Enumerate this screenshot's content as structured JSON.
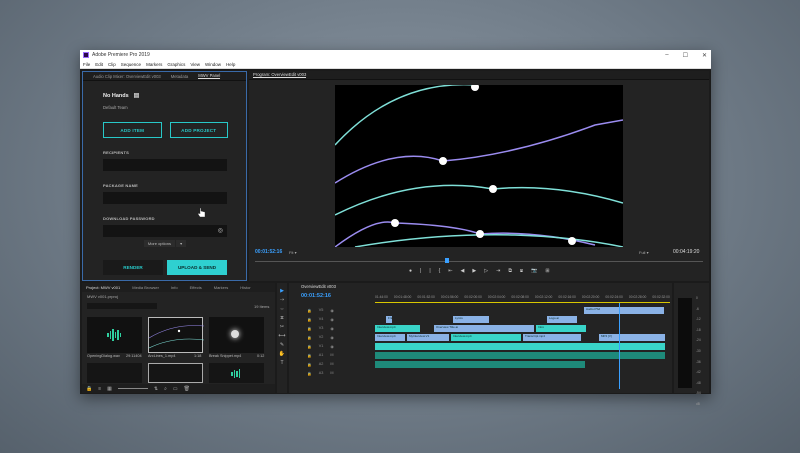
{
  "window": {
    "title": "Adobe Premiere Pro 2019",
    "controls": [
      "–",
      "☐",
      "✕"
    ]
  },
  "menu": [
    "File",
    "Edit",
    "Clip",
    "Sequence",
    "Markers",
    "Graphics",
    "View",
    "Window",
    "Help"
  ],
  "mwv_panel": {
    "tabs": [
      "Audio Clip Mixer: OverviewEdit v003",
      "Metadata",
      "MWV Panel"
    ],
    "active_tab": "MWV Panel",
    "name": "No Hands",
    "team": "Default Team",
    "add_item": "ADD ITEM",
    "add_project": "ADD PROJECT",
    "recipients_label": "RECIPIENTS",
    "package_label": "PACKAGE NAME",
    "password_label": "DOWNLOAD PASSWORD",
    "more_options": "More options",
    "render": "RENDER",
    "upload_send": "UPLOAD & SEND"
  },
  "program_monitor": {
    "tab": "Program: OverviewEdit v003",
    "timecode": "00:01:52:16",
    "fit": "Fit",
    "quality": "Full",
    "duration": "00:04:19:20",
    "transport": [
      "●",
      "|",
      "|",
      "{",
      "⇤",
      "◀",
      "▶",
      "▷",
      "⇥",
      "⧉",
      "⧈",
      "📷",
      "⊞"
    ]
  },
  "project_panel": {
    "tabs": [
      "Project: MWV v001",
      "Media Browser",
      "Info",
      "Effects",
      "Markers",
      "Histor"
    ],
    "file": "MWV v001.prproj",
    "count": "19 Items",
    "items": [
      {
        "name": "OpeningDialog.wav",
        "duration": "29:11404"
      },
      {
        "name": "ArcLines_1.mp4",
        "duration": "1:18"
      },
      {
        "name": "Break Snippet.mp4",
        "duration": "0:12"
      }
    ]
  },
  "tools": [
    "▶",
    "⇢",
    "⇔",
    "⧖",
    "✂",
    "⟷",
    "✎",
    "✋",
    "T"
  ],
  "timeline": {
    "tab": "OverviewEdit v003",
    "timecode": "00:01:52:16",
    "ruler": [
      "01:44:00",
      "00:01:48:00",
      "00:01:52:00",
      "00:01:56:00",
      "00:02:00:00",
      "00:02:04:00",
      "00:02:08:00",
      "00:02:12:00",
      "00:02:16:00",
      "00:02:20:00",
      "00:02:24:00",
      "00:02:28:00",
      "00:02:32:00"
    ],
    "tracks": [
      "V5",
      "V4",
      "V3",
      "V2",
      "V1",
      "A1",
      "A2",
      "A3"
    ],
    "clips": [
      {
        "label": "Audio.PSd",
        "type": "blue"
      },
      {
        "label": "Friend",
        "type": "blue"
      },
      {
        "label": "Lyrics",
        "type": "blue"
      },
      {
        "label": "Logo.ai",
        "type": "blue"
      },
      {
        "label": "Interview.mp4",
        "type": "teal"
      },
      {
        "label": "Overview Title.ai",
        "type": "blue"
      },
      {
        "label": "Intro",
        "type": "teal"
      },
      {
        "label": "Interview.mp4",
        "type": "blue"
      },
      {
        "label": "MyInterview.V1",
        "type": "blue"
      },
      {
        "label": "Interview.mp4",
        "type": "blue"
      },
      {
        "label": "Transcript.mp4",
        "type": "blue"
      },
      {
        "label": "MP4 [V]",
        "type": "blue"
      }
    ]
  },
  "meters": [
    "0",
    "-6",
    "-12",
    "-18",
    "-24",
    "-30",
    "-36",
    "-42",
    "-48",
    "-54",
    "dB"
  ]
}
